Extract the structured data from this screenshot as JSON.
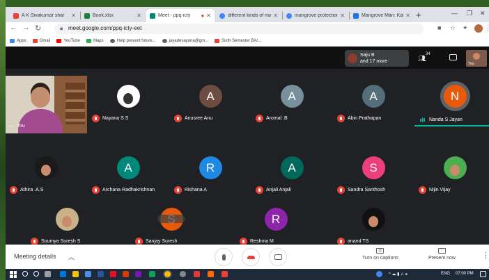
{
  "browser": {
    "tabs": [
      {
        "title": "A K Sivakumar shar",
        "favicon_color": "#ea4335",
        "active": false
      },
      {
        "title": "Book.xlsx",
        "favicon_color": "#188038",
        "active": false
      },
      {
        "title": "Meet - ppq-icty",
        "favicon_color": "#00897b",
        "active": true
      },
      {
        "title": "different kinds of ma",
        "favicon_color": "#4285f4",
        "active": false
      },
      {
        "title": "mangrove protection",
        "favicon_color": "#4285f4",
        "active": false
      },
      {
        "title": "Mangrove Man: Kaliya",
        "favicon_color": "#1a73e8",
        "active": false
      }
    ],
    "url": "meet.google.com/ppq-icty-eet",
    "bookmarks": [
      {
        "label": "Apps",
        "color": "#4285f4"
      },
      {
        "label": "Gmail",
        "color": "#ea4335"
      },
      {
        "label": "YouTube",
        "color": "#ff0000"
      },
      {
        "label": "Maps",
        "color": "#34a853"
      },
      {
        "label": "Help prevent future...",
        "color": "#5f6368"
      },
      {
        "label": "jayadevayona@gm...",
        "color": "#5f6368"
      },
      {
        "label": "Sixth Semester BA/...",
        "color": "#ea4335"
      }
    ]
  },
  "meet": {
    "presenter": {
      "line1": "Saju B",
      "line2": "and 17 more"
    },
    "people_count": "34",
    "self_thumb_label": "You",
    "self_tile_label": "You",
    "participants_row1": [
      {
        "name": "Nayana S S",
        "initial": "",
        "color": "#ffffff",
        "photo": true
      },
      {
        "name": "Anusree Anu",
        "initial": "A",
        "color": "#6d4c41"
      },
      {
        "name": "Aromal .B",
        "initial": "A",
        "color": "#78909c"
      },
      {
        "name": "Abin Prathapan",
        "initial": "A",
        "color": "#546e7a"
      },
      {
        "name": "Nanda S Jayan",
        "initial": "N",
        "color": "#e8590c",
        "speaking": true
      }
    ],
    "participants_row2": [
      {
        "name": "Athira .A.S",
        "initial": "",
        "color": "#1a1a1a",
        "photo": true
      },
      {
        "name": "Archana Radhakrishnan",
        "initial": "A",
        "color": "#00897b"
      },
      {
        "name": "Rishana A",
        "initial": "R",
        "color": "#1e88e5"
      },
      {
        "name": "Anjali Anjali",
        "initial": "A",
        "color": "#00695c"
      },
      {
        "name": "Sandra Santhosh",
        "initial": "S",
        "color": "#ec407a"
      },
      {
        "name": "Nijin Vijay",
        "initial": "",
        "color": "#4caf50",
        "photo": true
      }
    ],
    "participants_row3": [
      {
        "name": "Soumya Suresh S",
        "initial": "",
        "color": "#c9b28a",
        "photo": true
      },
      {
        "name": "Sanjay Suresh",
        "initial": "S",
        "color": "#e8590c"
      },
      {
        "name": "Reshma M",
        "initial": "R",
        "color": "#8e24aa"
      },
      {
        "name": "anand TS",
        "initial": "",
        "color": "#111111",
        "photo": true
      }
    ],
    "bottom": {
      "meeting_details": "Meeting details",
      "captions_label": "Turn on captions",
      "present_label": "Present now"
    }
  },
  "taskbar": {
    "lang": "ENG",
    "time": "07:00 PM"
  }
}
